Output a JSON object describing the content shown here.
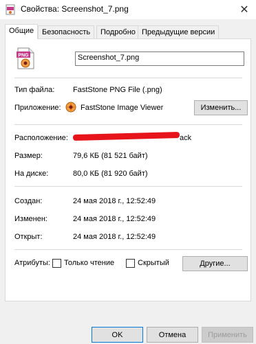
{
  "window": {
    "title": "Свойства: Screenshot_7.png",
    "close_symbol": "✕"
  },
  "tabs": [
    {
      "label": "Общие",
      "active": true
    },
    {
      "label": "Безопасность",
      "active": false
    },
    {
      "label": "Подробно",
      "active": false
    },
    {
      "label": "Предыдущие версии",
      "active": false
    }
  ],
  "general": {
    "file_name": "Screenshot_7.png",
    "file_type_label": "Тип файла:",
    "file_type_value": "FastStone PNG File (.png)",
    "app_label": "Приложение:",
    "app_value": "FastStone Image Viewer",
    "change_button": "Изменить...",
    "location_label": "Расположение:",
    "location_value_tail": "ack",
    "size_label": "Размер:",
    "size_value": "79,6 КБ (81 521 байт)",
    "disk_label": "На диске:",
    "disk_value": "80,0 КБ (81 920 байт)",
    "created_label": "Создан:",
    "created_value": "24 мая 2018 г., 12:52:49",
    "modified_label": "Изменен:",
    "modified_value": "24 мая 2018 г., 12:52:49",
    "opened_label": "Открыт:",
    "opened_value": "24 мая 2018 г., 12:52:49",
    "attributes_label": "Атрибуты:",
    "readonly_label": "Только чтение",
    "readonly_checked": false,
    "hidden_label": "Скрытый",
    "hidden_checked": false,
    "other_button": "Другие..."
  },
  "footer": {
    "ok": "OK",
    "cancel": "Отмена",
    "apply": "Применить"
  },
  "icons": {
    "file_badge": "PNG",
    "colors": {
      "badge": "#c43b8a",
      "app_orange": "#e0701e",
      "redaction": "#e8141c"
    }
  }
}
